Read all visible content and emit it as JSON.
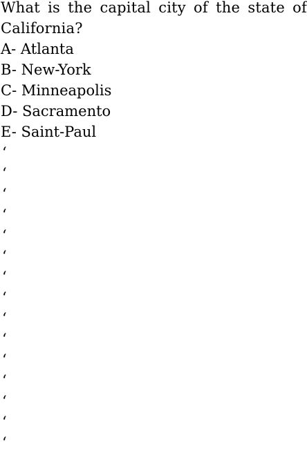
{
  "question": {
    "text": "What is the capital city of the state of California?"
  },
  "options": [
    {
      "label": "A- Atlanta"
    },
    {
      "label": "B- New-York"
    },
    {
      "label": "C- Minneapolis"
    },
    {
      "label": "D- Sacramento"
    },
    {
      "label": "E- Saint-Paul"
    }
  ],
  "trailing_marks": [
    "‘",
    "‘",
    "‘",
    "‘",
    "‘",
    "‘",
    "‘",
    "‘",
    "‘",
    "‘",
    "‘",
    "‘",
    "‘",
    "‘",
    "‘"
  ]
}
